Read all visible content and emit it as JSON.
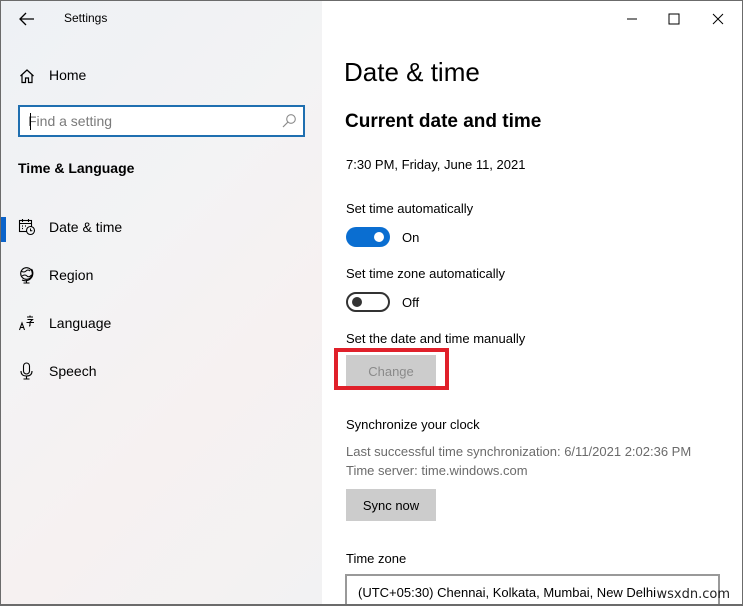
{
  "window": {
    "app_title": "Settings",
    "controls": {
      "minimize": "minimize",
      "maximize": "maximize",
      "close": "close"
    }
  },
  "sidebar": {
    "home_label": "Home",
    "search": {
      "placeholder": "Find a setting",
      "value": ""
    },
    "section_title": "Time & Language",
    "items": [
      {
        "label": "Date & time",
        "icon": "calendar-clock-icon",
        "active": true
      },
      {
        "label": "Region",
        "icon": "globe-icon",
        "active": false
      },
      {
        "label": "Language",
        "icon": "language-icon",
        "active": false
      },
      {
        "label": "Speech",
        "icon": "microphone-icon",
        "active": false
      }
    ],
    "accent_color": "#0b63c9"
  },
  "main": {
    "page_title": "Date & time",
    "current_section_title": "Current date and time",
    "current_datetime": "7:30 PM, Friday, June 11, 2021",
    "set_time_auto": {
      "label": "Set time automatically",
      "state": "On",
      "checked": true
    },
    "set_timezone_auto": {
      "label": "Set time zone automatically",
      "state": "Off",
      "checked": false
    },
    "manual": {
      "label": "Set the date and time manually",
      "button_label": "Change",
      "disabled": true,
      "highlight_color": "#e0202a"
    },
    "sync": {
      "title": "Synchronize your clock",
      "last_sync": "Last successful time synchronization: 6/11/2021 2:02:36 PM",
      "server": "Time server: time.windows.com",
      "button_label": "Sync now"
    },
    "timezone": {
      "label": "Time zone",
      "selected": "(UTC+05:30) Chennai, Kolkata, Mumbai, New Delhi"
    },
    "toggle_on_color": "#0a6ed1"
  },
  "watermark": "wsxdn.com"
}
